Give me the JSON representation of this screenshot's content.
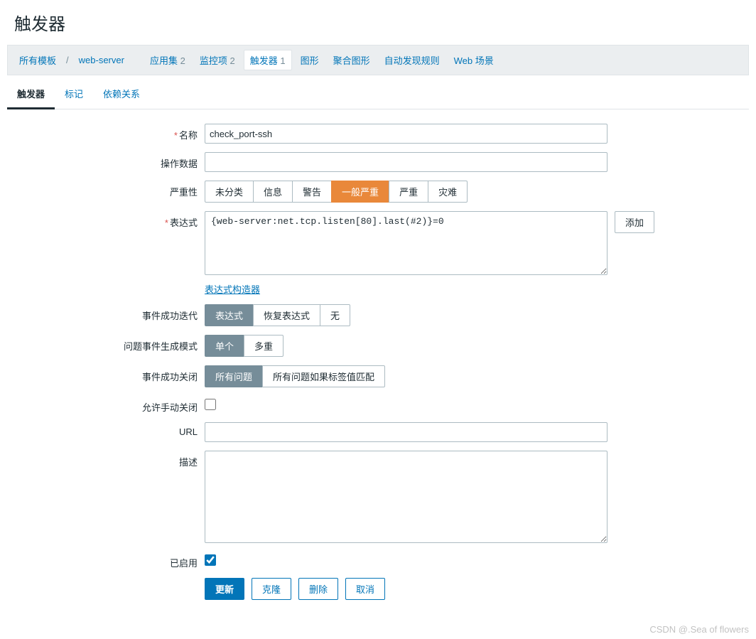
{
  "page_title": "触发器",
  "breadcrumb": {
    "all_templates": "所有模板",
    "template_name": "web-server"
  },
  "nav": {
    "app_set": "应用集",
    "app_set_count": "2",
    "items": "监控项",
    "items_count": "2",
    "triggers": "触发器",
    "triggers_count": "1",
    "graphs": "图形",
    "screens": "聚合图形",
    "discovery": "自动发现规则",
    "web": "Web 场景"
  },
  "tabs": {
    "trigger": "触发器",
    "tags": "标记",
    "deps": "依赖关系"
  },
  "form": {
    "name_label": "名称",
    "name_value": "check_port-ssh",
    "op_data_label": "操作数据",
    "op_data_value": "",
    "severity_label": "严重性",
    "severity_options": [
      "未分类",
      "信息",
      "警告",
      "一般严重",
      "严重",
      "灾难"
    ],
    "expr_label": "表达式",
    "expr_value": "{web-server:net.tcp.listen[80].last(#2)}=0",
    "add_btn": "添加",
    "expr_constructor": "表达式构造器",
    "ok_event_gen_label": "事件成功迭代",
    "ok_event_options": [
      "表达式",
      "恢复表达式",
      "无"
    ],
    "problem_mode_label": "问题事件生成模式",
    "problem_mode_options": [
      "单个",
      "多重"
    ],
    "ok_close_label": "事件成功关闭",
    "ok_close_options": [
      "所有问题",
      "所有问题如果标签值匹配"
    ],
    "manual_close_label": "允许手动关闭",
    "url_label": "URL",
    "url_value": "",
    "desc_label": "描述",
    "desc_value": "",
    "enabled_label": "已启用",
    "enabled_checked": true,
    "update_btn": "更新",
    "clone_btn": "克隆",
    "delete_btn": "删除",
    "cancel_btn": "取消"
  },
  "watermark": "CSDN @.Sea of flowers"
}
